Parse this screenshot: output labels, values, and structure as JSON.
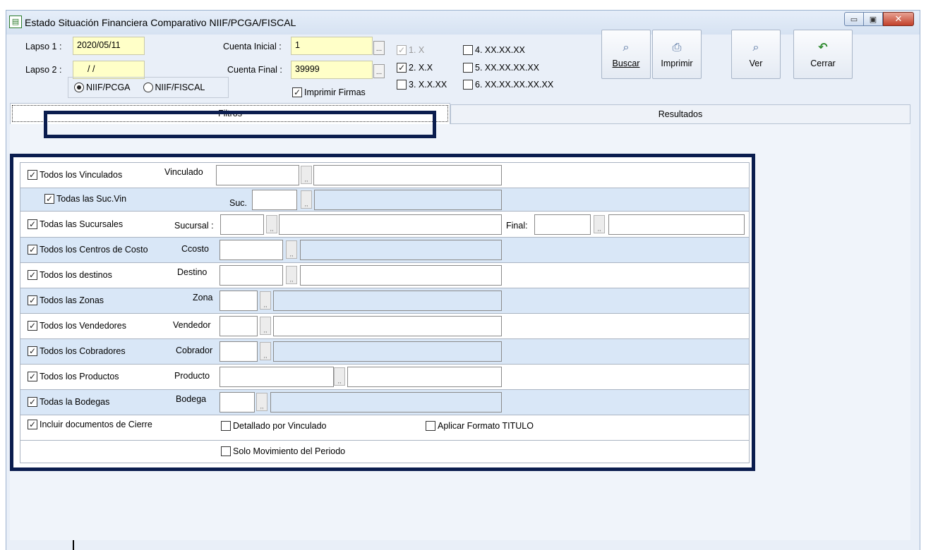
{
  "window": {
    "title": "Estado Situación Financiera Comparativo NIIF/PCGA/FISCAL",
    "icon": "spreadsheet-icon",
    "close_glyph": "✕",
    "min_glyph": "▭",
    "max_glyph": "▣"
  },
  "header": {
    "lapso1_label": "Lapso 1 :",
    "lapso1_value": "2020/05/11",
    "lapso2_label": "Lapso 2 :",
    "lapso2_value": "/ /",
    "cuenta_inicial_label": "Cuenta Inicial :",
    "cuenta_inicial_value": "1",
    "cuenta_final_label": "Cuenta Final :",
    "cuenta_final_value": "39999",
    "dots": "...",
    "radio_niif_pcga": "NIIF/PCGA",
    "radio_niif_fiscal": "NIIF/FISCAL",
    "imprimir_firmas": "Imprimir Firmas",
    "levels": [
      {
        "label": "1. X",
        "checked": true,
        "disabled": true
      },
      {
        "label": "2. X.X",
        "checked": true,
        "disabled": false
      },
      {
        "label": "3. X.X.XX",
        "checked": false,
        "disabled": false
      },
      {
        "label": "4. XX.XX.XX",
        "checked": false,
        "disabled": false
      },
      {
        "label": "5. XX.XX.XX.XX",
        "checked": false,
        "disabled": false
      },
      {
        "label": "6. XX.XX.XX.XX.XX",
        "checked": false,
        "disabled": false
      }
    ]
  },
  "toolbar": {
    "buscar": "Buscar",
    "imprimir": "Imprimir",
    "ver": "Ver",
    "cerrar": "Cerrar"
  },
  "tabs": {
    "filtros": "Filtros",
    "resultados": "Resultados"
  },
  "filters": {
    "vinculados": {
      "check": "Todos los Vinculados",
      "label": "Vinculado"
    },
    "suc_vin": {
      "check": "Todas las Suc.Vin",
      "label": "Suc."
    },
    "sucursales": {
      "check": "Todas las Sucursales",
      "label": "Sucursal :",
      "final_label": "Final:"
    },
    "centros": {
      "check": "Todos los Centros de Costo",
      "label": "Ccosto"
    },
    "destinos": {
      "check": "Todos los destinos",
      "label": "Destino"
    },
    "zonas": {
      "check": "Todos las Zonas",
      "label": "Zona"
    },
    "vendedores": {
      "check": "Todos los Vendedores",
      "label": "Vendedor"
    },
    "cobradores": {
      "check": "Todos los Cobradores",
      "label": "Cobrador"
    },
    "productos": {
      "check": "Todos los Productos",
      "label": "Producto"
    },
    "bodegas": {
      "check": "Todas la Bodegas",
      "label": "Bodega"
    },
    "cierre": "Incluir documentos de Cierre",
    "detallado": "Detallado por Vinculado",
    "formato": "Aplicar Formato TITULO",
    "solo_mov": "Solo Movimiento del Periodo"
  },
  "check_glyph": "✓",
  "small_dots": ",,"
}
